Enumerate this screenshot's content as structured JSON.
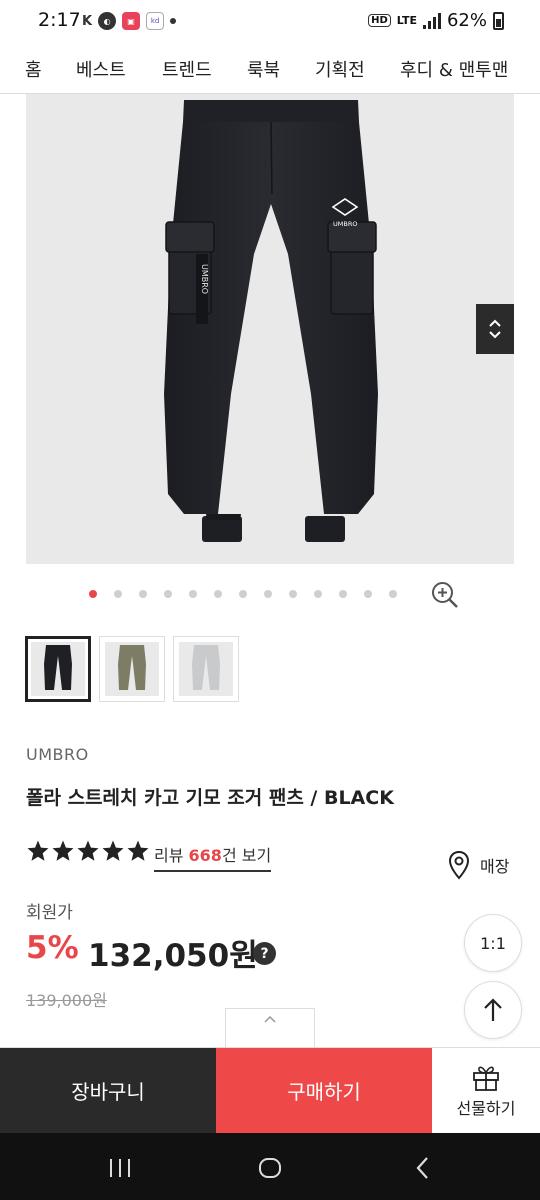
{
  "status_bar": {
    "time": "2:17",
    "network": "LTE",
    "battery": "62%"
  },
  "top_nav": {
    "items": [
      "홈",
      "베스트",
      "트렌드",
      "룩북",
      "기획전",
      "후디 & 맨투맨"
    ]
  },
  "gallery": {
    "image_alt_brand_print": "UMBRO",
    "dots_total": 13,
    "active_dot": 0,
    "thumbnails": [
      {
        "color_name": "black",
        "color": "#1f2024",
        "selected": true
      },
      {
        "color_name": "khaki",
        "color": "#7d7d66",
        "selected": false
      },
      {
        "color_name": "grey",
        "color": "#c9cacb",
        "selected": false
      }
    ]
  },
  "product": {
    "brand": "UMBRO",
    "title": "폴라 스트레치 카고 기모 조거 팬츠 / BLACK",
    "rating_stars": 5,
    "review_prefix": "리뷰 ",
    "review_count": "668",
    "review_suffix": "건 보기",
    "store_label": "매장",
    "member_price_label": "회원가",
    "discount": "5%",
    "price": "132,050원",
    "help_label": "?",
    "original_price": "139,000원"
  },
  "floating": {
    "ratio_label": "1:1"
  },
  "actions": {
    "cart_label": "장바구니",
    "buy_label": "구매하기",
    "gift_label": "선물하기"
  },
  "colors": {
    "accent": "#ee4848",
    "dark": "#2a2a2a"
  }
}
